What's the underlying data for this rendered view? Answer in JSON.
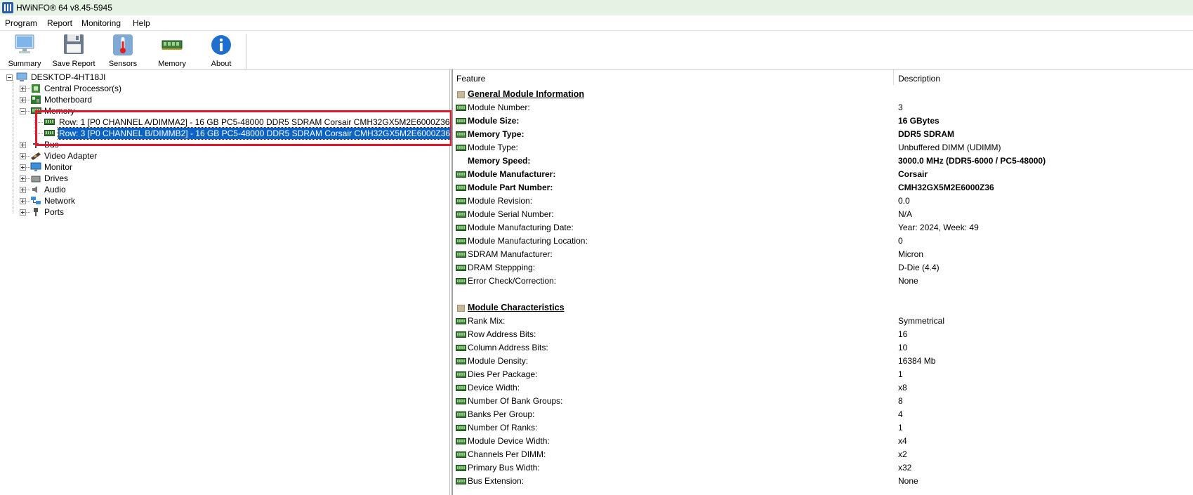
{
  "window": {
    "title": "HWiNFO® 64 v8.45-5945"
  },
  "menu": [
    "Program",
    "Report",
    "Monitoring",
    "Help"
  ],
  "toolbar": [
    {
      "label": "Summary",
      "icon": "monitor-icon"
    },
    {
      "label": "Save Report",
      "icon": "floppy-icon"
    },
    {
      "label": "Sensors",
      "icon": "thermometer-icon"
    },
    {
      "label": "Memory",
      "icon": "ram-icon"
    },
    {
      "label": "About",
      "icon": "info-icon"
    }
  ],
  "tree": {
    "root": "DESKTOP-4HT18JI",
    "nodes": [
      "Central Processor(s)",
      "Motherboard",
      "Memory",
      "Bus",
      "Video Adapter",
      "Monitor",
      "Drives",
      "Audio",
      "Network",
      "Ports"
    ],
    "memory_children": [
      "Row: 1 [P0 CHANNEL A/DIMMA2] - 16 GB PC5-48000 DDR5 SDRAM Corsair CMH32GX5M2E6000Z36",
      "Row: 3 [P0 CHANNEL B/DIMMB2] - 16 GB PC5-48000 DDR5 SDRAM Corsair CMH32GX5M2E6000Z36"
    ],
    "selected_index": 1
  },
  "details": {
    "columns": [
      "Feature",
      "Description"
    ],
    "rows": [
      {
        "section": true,
        "feature": "General Module Information",
        "value": ""
      },
      {
        "feature": "Module Number:",
        "value": "3"
      },
      {
        "feature": "Module Size:",
        "value": "16 GBytes",
        "bold": true
      },
      {
        "feature": "Memory Type:",
        "value": "DDR5 SDRAM",
        "bold": true
      },
      {
        "feature": "Module Type:",
        "value": "Unbuffered DIMM (UDIMM)"
      },
      {
        "feature": "Memory Speed:",
        "value": "3000.0 MHz (DDR5-6000 / PC5-48000)",
        "bold": true,
        "noicon": true
      },
      {
        "feature": "Module Manufacturer:",
        "value": "Corsair",
        "bold": true
      },
      {
        "feature": "Module Part Number:",
        "value": "CMH32GX5M2E6000Z36",
        "bold": true
      },
      {
        "feature": "Module Revision:",
        "value": "0.0"
      },
      {
        "feature": "Module Serial Number:",
        "value": "N/A"
      },
      {
        "feature": "Module Manufacturing Date:",
        "value": "Year: 2024, Week: 49"
      },
      {
        "feature": "Module Manufacturing Location:",
        "value": "0"
      },
      {
        "feature": "SDRAM Manufacturer:",
        "value": "Micron"
      },
      {
        "feature": "DRAM Steppping:",
        "value": "D-Die (4.4)"
      },
      {
        "feature": "Error Check/Correction:",
        "value": "None"
      },
      {
        "blank": true
      },
      {
        "section": true,
        "feature": "Module Characteristics",
        "value": ""
      },
      {
        "feature": "Rank Mix:",
        "value": "Symmetrical"
      },
      {
        "feature": "Row Address Bits:",
        "value": "16"
      },
      {
        "feature": "Column Address Bits:",
        "value": "10"
      },
      {
        "feature": "Module Density:",
        "value": "16384 Mb"
      },
      {
        "feature": "Dies Per Package:",
        "value": "1"
      },
      {
        "feature": "Device Width:",
        "value": "x8"
      },
      {
        "feature": "Number Of Bank Groups:",
        "value": "8"
      },
      {
        "feature": "Banks Per Group:",
        "value": "4"
      },
      {
        "feature": "Number Of Ranks:",
        "value": "1"
      },
      {
        "feature": "Module Device Width:",
        "value": "x4"
      },
      {
        "feature": "Channels Per DIMM:",
        "value": "x2"
      },
      {
        "feature": "Primary Bus Width:",
        "value": "x32"
      },
      {
        "feature": "Bus Extension:",
        "value": "None"
      }
    ]
  },
  "colors": {
    "highlight": "#e3182d",
    "selection": "#0a64c8"
  }
}
